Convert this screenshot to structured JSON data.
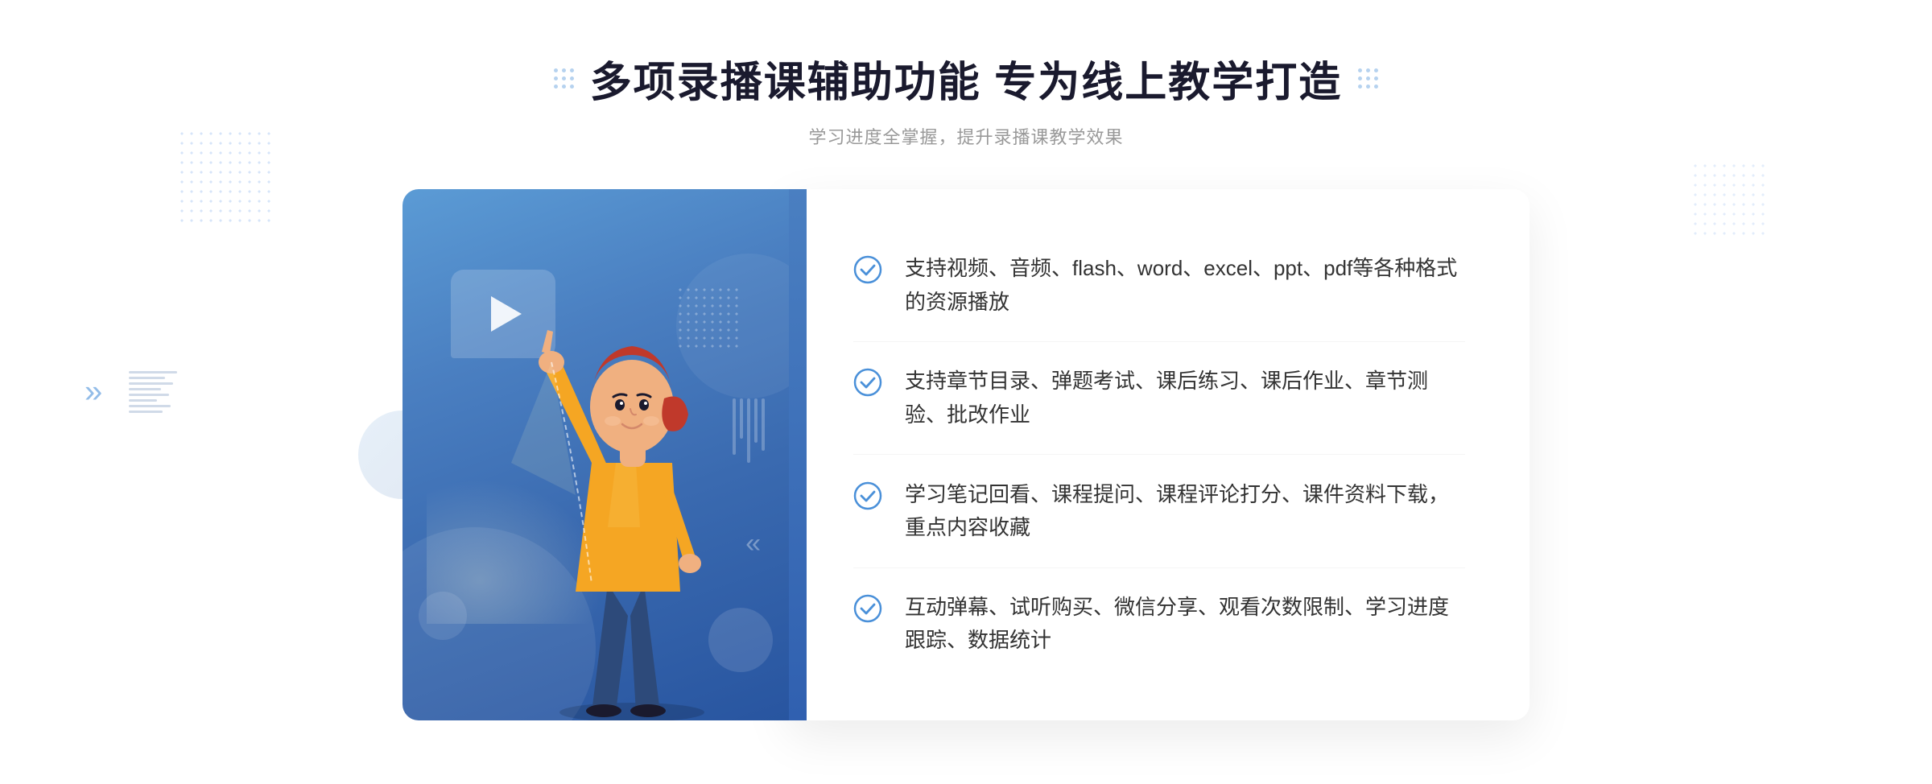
{
  "header": {
    "title": "多项录播课辅助功能 专为线上教学打造",
    "subtitle": "学习进度全掌握，提升录播课教学效果"
  },
  "features": [
    {
      "id": "feature-1",
      "text": "支持视频、音频、flash、word、excel、ppt、pdf等各种格式的资源播放"
    },
    {
      "id": "feature-2",
      "text": "支持章节目录、弹题考试、课后练习、课后作业、章节测验、批改作业"
    },
    {
      "id": "feature-3",
      "text": "学习笔记回看、课程提问、课程评论打分、课件资料下载，重点内容收藏"
    },
    {
      "id": "feature-4",
      "text": "互动弹幕、试听购买、微信分享、观看次数限制、学习进度跟踪、数据统计"
    }
  ],
  "decorations": {
    "chevron_left": "»",
    "dots_left_label": "dots-left",
    "dots_right_label": "dots-right"
  },
  "colors": {
    "brand_blue": "#4a7fc1",
    "dark_blue": "#2855a0",
    "text_dark": "#1a1a2e",
    "text_light": "#999999",
    "text_body": "#333333",
    "check_circle": "#4a90d9"
  }
}
